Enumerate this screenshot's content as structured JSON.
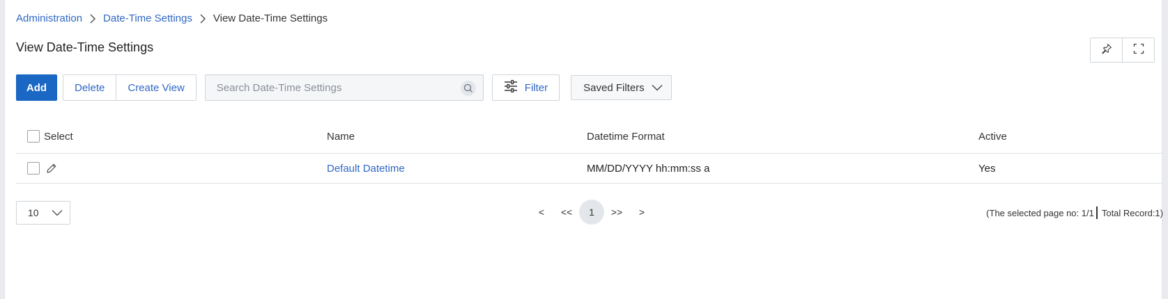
{
  "breadcrumb": {
    "items": [
      "Administration",
      "Date-Time Settings"
    ],
    "current": "View Date-Time Settings"
  },
  "page": {
    "title": "View Date-Time Settings"
  },
  "toolbar": {
    "add_label": "Add",
    "delete_label": "Delete",
    "create_view_label": "Create View",
    "search_placeholder": "Search Date-Time Settings",
    "filter_label": "Filter",
    "saved_filters_label": "Saved Filters"
  },
  "table": {
    "columns": [
      "Select",
      "Name",
      "Datetime Format",
      "Active"
    ],
    "rows": [
      {
        "name": "Default Datetime",
        "format": "MM/DD/YYYY hh:mm:ss a",
        "active": "Yes"
      }
    ]
  },
  "pagination": {
    "page_size": "10",
    "prev": "<",
    "first": "<<",
    "current_page": "1",
    "last": ">>",
    "next": ">",
    "selected_page_text": "(The selected page no: 1/1",
    "total_text": "Total Record:1)"
  },
  "colors": {
    "primary": "#1a67c4",
    "link": "#2f67c4"
  },
  "icons": {
    "breadcrumb_sep": "chevron-right-icon",
    "pin": "pin-icon",
    "fullscreen": "fullscreen-icon",
    "search": "search-icon",
    "filter": "sliders-icon",
    "dropdown": "chevron-down-icon",
    "edit": "pencil-icon"
  }
}
